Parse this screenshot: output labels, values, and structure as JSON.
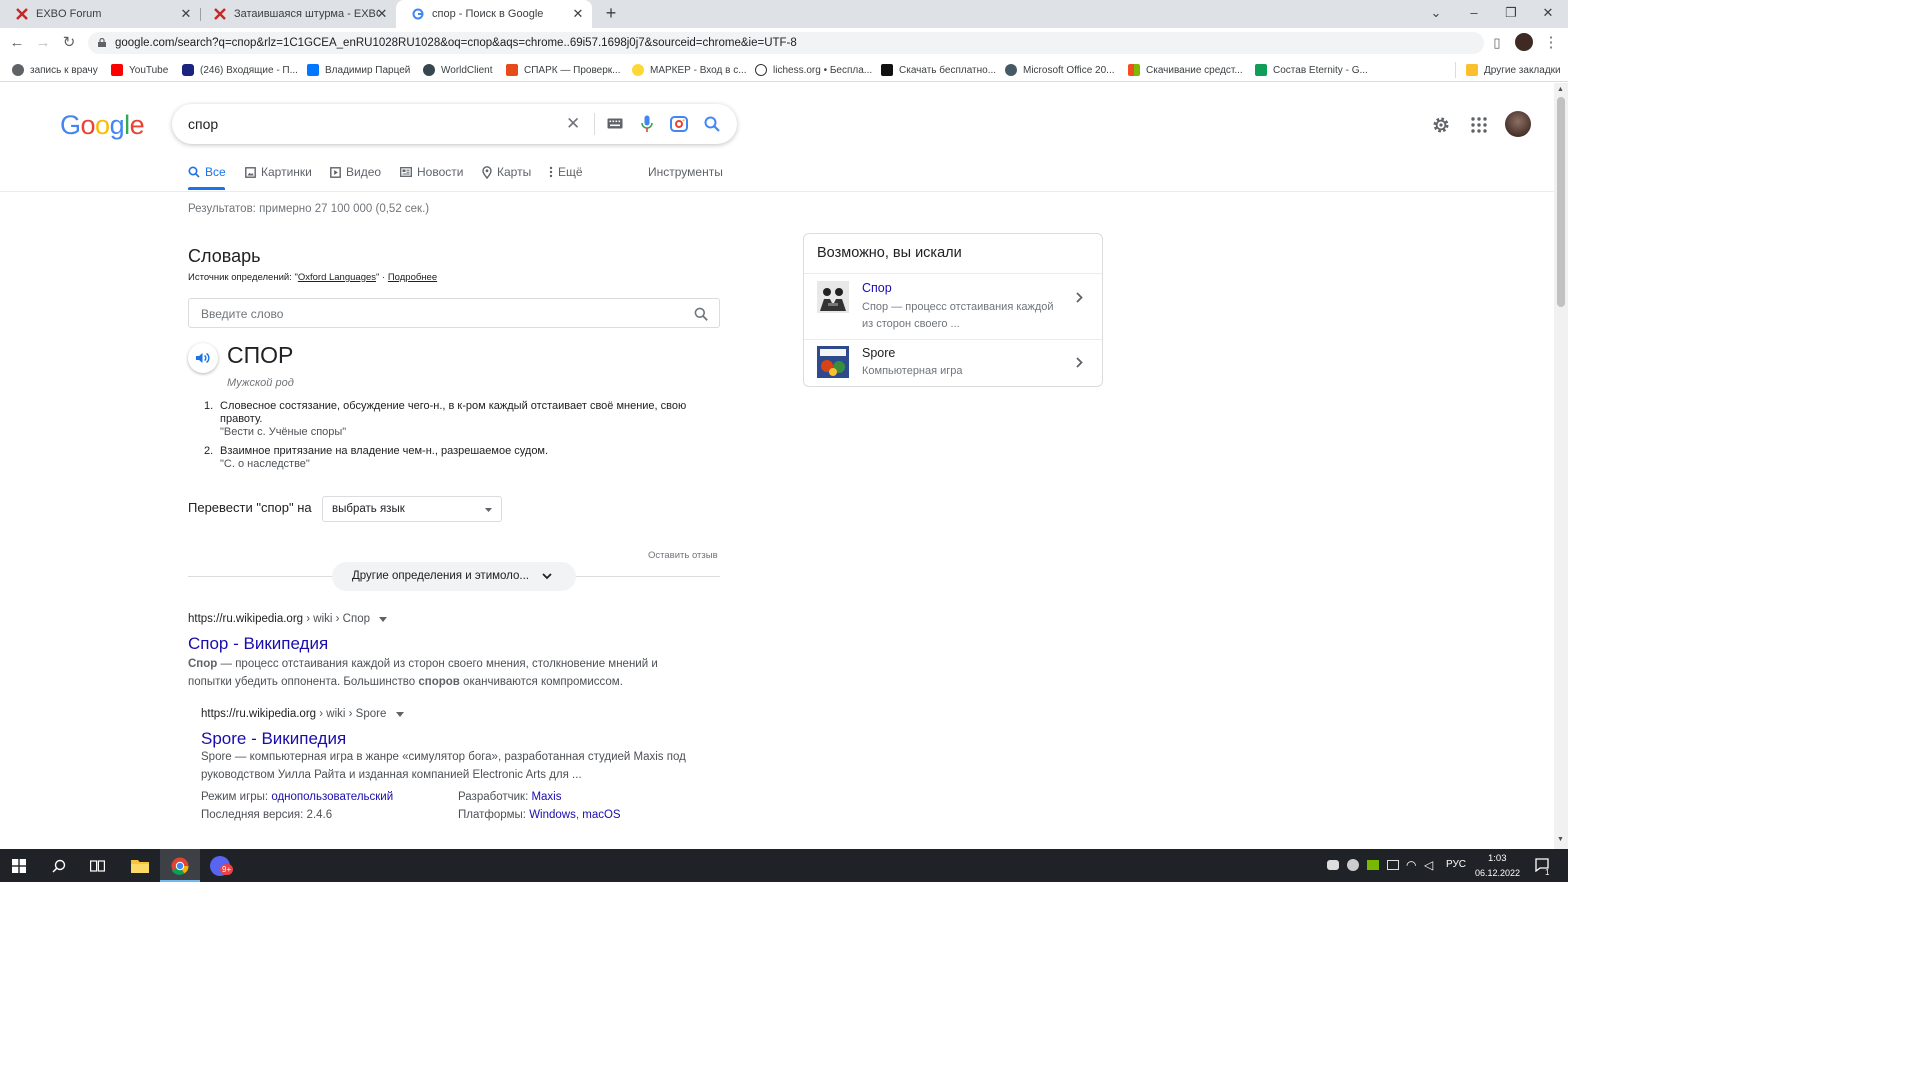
{
  "browser": {
    "tabs": [
      {
        "title": "EXBO Forum",
        "active": false
      },
      {
        "title": "Затаившаяся штурма - EXBO For",
        "active": false
      },
      {
        "title": "спор - Поиск в Google",
        "active": true
      }
    ],
    "url": "google.com/search?q=спор&rlz=1C1GCEA_enRU1028RU1028&oq=спор&aqs=chrome..69i57.1698j0j7&sourceid=chrome&ie=UTF-8",
    "bookmarks": [
      {
        "label": "запись к врачу",
        "icon": "globe-icon"
      },
      {
        "label": "YouTube",
        "icon": "youtube-icon"
      },
      {
        "label": "(246) Входящие - П...",
        "icon": "mail-icon"
      },
      {
        "label": "Владимир Парцей",
        "icon": "vk-icon"
      },
      {
        "label": "WorldClient",
        "icon": "globe-icon"
      },
      {
        "label": "СПАРК — Проверк...",
        "icon": "spark-icon"
      },
      {
        "label": "МАРКЕР - Вход в с...",
        "icon": "marker-icon"
      },
      {
        "label": "lichess.org • Бесплa...",
        "icon": "lichess-icon"
      },
      {
        "label": "Скачать бесплатно...",
        "icon": "download-icon"
      },
      {
        "label": "Microsoft Office 20...",
        "icon": "office-icon"
      },
      {
        "label": "Скачивание средст...",
        "icon": "windows-icon"
      },
      {
        "label": "Состав Eternity - G...",
        "icon": "sheets-icon"
      }
    ],
    "other_bookmarks": "Другие закладки"
  },
  "search": {
    "logo": "Google",
    "query": "спор",
    "tabs": [
      "Все",
      "Картинки",
      "Видео",
      "Новости",
      "Карты",
      "Ещё"
    ],
    "tools": "Инструменты",
    "stats": "Результатов: примерно 27 100 000 (0,52 сек.)"
  },
  "dictionary": {
    "title": "Словарь",
    "source_prefix": "Источник определений: \"",
    "source": "Oxford Languages",
    "source_suffix": "\" · ",
    "more": "Подробнее",
    "input_placeholder": "Введите слово",
    "word": "СПОР",
    "gender": "Мужской род",
    "definitions": [
      {
        "num": "1.",
        "text": "Словесное состязание, обсуждение чего-н., в к-ром каждый отстаивает своё мнение, свою правоту.",
        "example": "\"Вести с. Учёные споры\""
      },
      {
        "num": "2.",
        "text": "Взаимное притязание на владение чем-н., разрешаемое судом.",
        "example": "\"С. о наследстве\""
      }
    ],
    "translate_label": "Перевести \"спор\" на",
    "translate_select": "выбрать язык",
    "feedback": "Оставить отзыв",
    "more_defs": "Другие определения и этимоло..."
  },
  "results": [
    {
      "cite": "https://ru.wikipedia.org",
      "path": " › wiki › Спор",
      "title": "Спор - Википедия",
      "snippet_bold1": "Спор",
      "snippet1": " — процесс отстаивания каждой из сторон своего мнения, столкновение мнений и",
      "snippet2a": "попытки убедить оппонента. Большинство ",
      "snippet_bold2": "споров",
      "snippet2b": " оканчиваются компромиссом."
    },
    {
      "cite": "https://ru.wikipedia.org",
      "path": " › wiki › Spore",
      "title": "Spore - Википедия",
      "snippet1": "Spore — компьютерная игра в жанре «симулятор бога», разработанная студией Maxis под",
      "snippet2": "руководством Уилла Райта и изданная компанией Electronic Arts для ...",
      "facts": [
        {
          "label": "Режим игры: ",
          "value": "однопользовательский"
        },
        {
          "label": "Последняя версия: ",
          "value": "2.4.6"
        },
        {
          "label": "Разработчик: ",
          "value": "Maxis"
        },
        {
          "label": "Платформы: ",
          "value": "Windows",
          "value2": "macOS"
        }
      ]
    }
  ],
  "sidebar": {
    "title": "Возможно, вы искали",
    "items": [
      {
        "title": "Спор",
        "desc1": "Спор — процесс отстаивания каждой",
        "desc2": "из сторон своего ..."
      },
      {
        "title": "Spore",
        "desc1": "Компьютерная игра",
        "desc2": ""
      }
    ]
  },
  "taskbar": {
    "lang": "РУС",
    "time": "1:03",
    "date": "06.12.2022",
    "badge": "9+",
    "notif": "1"
  }
}
